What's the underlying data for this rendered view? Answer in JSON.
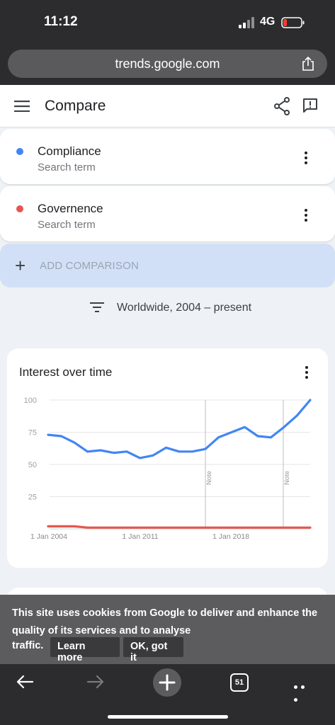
{
  "status": {
    "time": "11:12",
    "network": "4G"
  },
  "browser": {
    "url": "trends.google.com",
    "tab_count": "51"
  },
  "header": {
    "title": "Compare"
  },
  "terms": [
    {
      "name": "Compliance",
      "sub": "Search term",
      "color": "#4285f4"
    },
    {
      "name": "Governence",
      "sub": "Search term",
      "color": "#e8554e"
    }
  ],
  "add_comparison": "ADD COMPARISON",
  "filter": {
    "text": "Worldwide, 2004 – present"
  },
  "chart": {
    "title": "Interest over time"
  },
  "chart_data": {
    "type": "line",
    "x_ticks": [
      "1 Jan 2004",
      "1 Jan 2011",
      "1 Jan 2018"
    ],
    "y_ticks": [
      100,
      75,
      50,
      25
    ],
    "ylim": [
      0,
      100
    ],
    "annotations": [
      "Note",
      "Note"
    ],
    "series": [
      {
        "color": "#4285f4",
        "values": [
          73,
          72,
          67,
          60,
          61,
          59,
          60,
          55,
          57,
          63,
          60,
          60,
          62,
          71,
          75,
          79,
          72,
          71,
          79,
          88,
          100
        ]
      },
      {
        "color": "#e8554e",
        "values": [
          2,
          2,
          2,
          1,
          1,
          1,
          1,
          1,
          1,
          1,
          1,
          1,
          1,
          1,
          1,
          1,
          1,
          1,
          1,
          1,
          1
        ]
      }
    ]
  },
  "cookie": {
    "message": "This site uses cookies from Google to deliver and enhance the quality of its services and to analyse",
    "message_end": "traffic.",
    "learn_more": "Learn more",
    "ok": "OK, got it"
  }
}
